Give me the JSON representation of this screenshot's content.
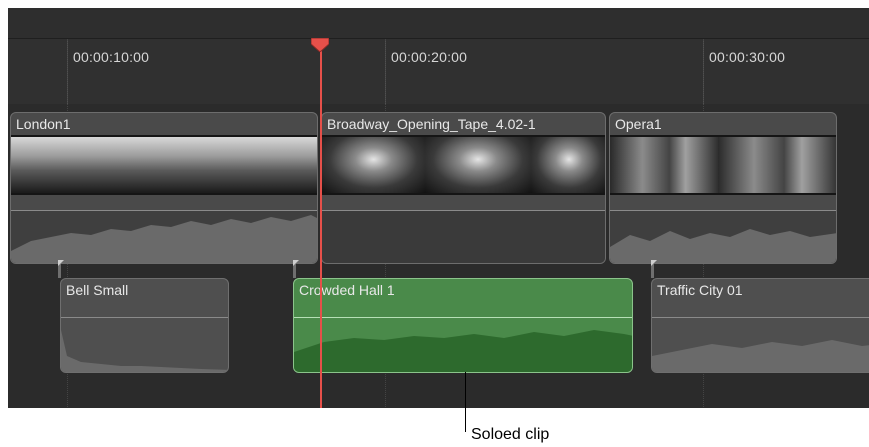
{
  "ruler": {
    "timecodes": [
      "00:00:10:00",
      "00:00:20:00",
      "00:00:30:00"
    ]
  },
  "primary_clips": [
    {
      "name": "London1"
    },
    {
      "name": "Broadway_Opening_Tape_4.02-1"
    },
    {
      "name": "Opera1"
    }
  ],
  "connected_clips": [
    {
      "name": "Bell Small"
    },
    {
      "name": "Crowded Hall 1",
      "state": "soloed"
    },
    {
      "name": "Traffic City 01"
    }
  ],
  "callout": {
    "label": "Soloed clip"
  },
  "colors": {
    "playhead": "#e6504a",
    "soloed_clip": "#4a8a4a",
    "timeline_bg": "#2b2b2b"
  }
}
